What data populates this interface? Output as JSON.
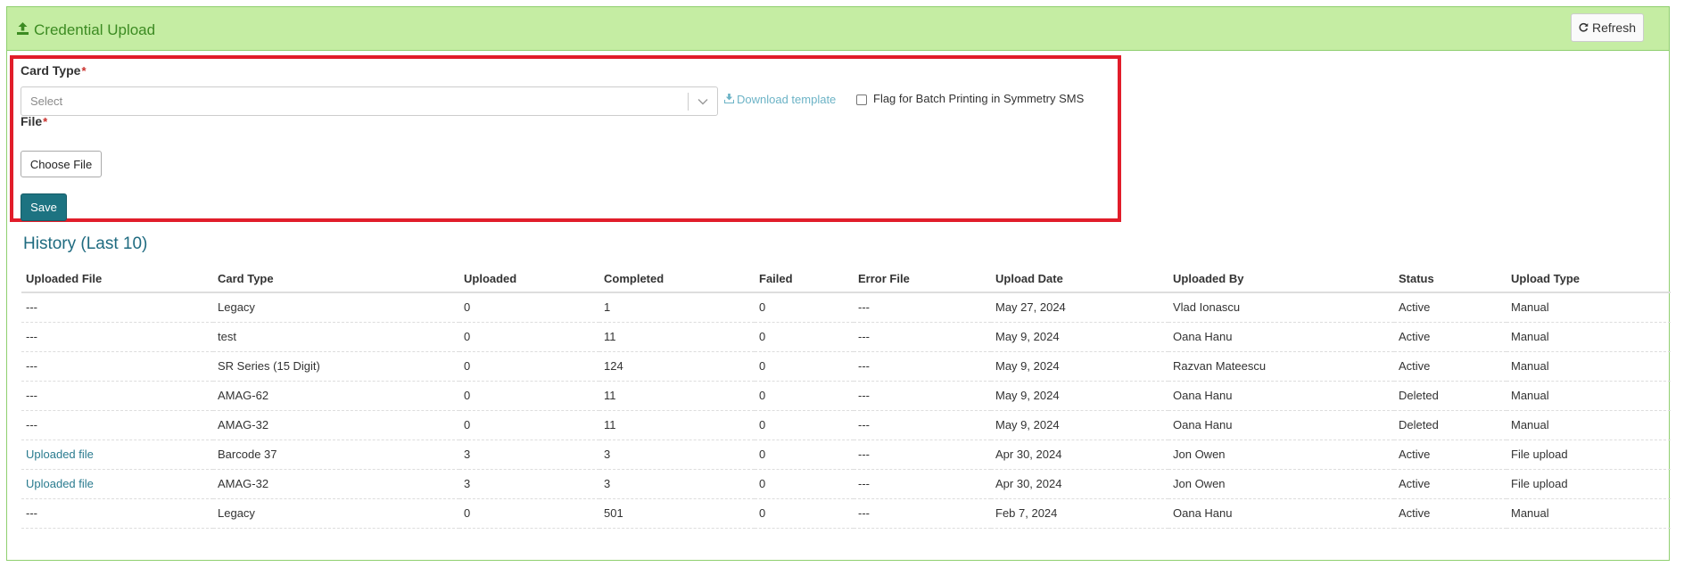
{
  "header": {
    "title": "Credential Upload",
    "title_icon": "upload-icon",
    "refresh_label": "Refresh",
    "refresh_icon": "refresh-icon"
  },
  "form": {
    "card_type_label": "Card Type",
    "required_mark": "*",
    "card_type_placeholder": "Select",
    "download_template_label": "Download template",
    "flag_label": "Flag for Batch Printing in Symmetry SMS",
    "flag_checked": false,
    "file_label": "File",
    "choose_file_label": "Choose File",
    "save_label": "Save"
  },
  "history": {
    "title": "History (Last 10)",
    "columns": [
      "Uploaded File",
      "Card Type",
      "Uploaded",
      "Completed",
      "Failed",
      "Error File",
      "Upload Date",
      "Uploaded By",
      "Status",
      "Upload Type"
    ],
    "rows": [
      {
        "uploaded_file": "---",
        "is_link": false,
        "card_type": "Legacy",
        "uploaded": "0",
        "completed": "1",
        "failed": "0",
        "error_file": "---",
        "upload_date": "May 27, 2024",
        "uploaded_by": "Vlad Ionascu",
        "status": "Active",
        "upload_type": "Manual"
      },
      {
        "uploaded_file": "---",
        "is_link": false,
        "card_type": "test",
        "uploaded": "0",
        "completed": "11",
        "failed": "0",
        "error_file": "---",
        "upload_date": "May 9, 2024",
        "uploaded_by": "Oana Hanu",
        "status": "Active",
        "upload_type": "Manual"
      },
      {
        "uploaded_file": "---",
        "is_link": false,
        "card_type": "SR Series (15 Digit)",
        "uploaded": "0",
        "completed": "124",
        "failed": "0",
        "error_file": "---",
        "upload_date": "May 9, 2024",
        "uploaded_by": "Razvan Mateescu",
        "status": "Active",
        "upload_type": "Manual"
      },
      {
        "uploaded_file": "---",
        "is_link": false,
        "card_type": "AMAG-62",
        "uploaded": "0",
        "completed": "11",
        "failed": "0",
        "error_file": "---",
        "upload_date": "May 9, 2024",
        "uploaded_by": "Oana Hanu",
        "status": "Deleted",
        "upload_type": "Manual"
      },
      {
        "uploaded_file": "---",
        "is_link": false,
        "card_type": "AMAG-32",
        "uploaded": "0",
        "completed": "11",
        "failed": "0",
        "error_file": "---",
        "upload_date": "May 9, 2024",
        "uploaded_by": "Oana Hanu",
        "status": "Deleted",
        "upload_type": "Manual"
      },
      {
        "uploaded_file": "Uploaded file",
        "is_link": true,
        "card_type": "Barcode 37",
        "uploaded": "3",
        "completed": "3",
        "failed": "0",
        "error_file": "---",
        "upload_date": "Apr 30, 2024",
        "uploaded_by": "Jon Owen",
        "status": "Active",
        "upload_type": "File upload"
      },
      {
        "uploaded_file": "Uploaded file",
        "is_link": true,
        "card_type": "AMAG-32",
        "uploaded": "3",
        "completed": "3",
        "failed": "0",
        "error_file": "---",
        "upload_date": "Apr 30, 2024",
        "uploaded_by": "Jon Owen",
        "status": "Active",
        "upload_type": "File upload"
      },
      {
        "uploaded_file": "---",
        "is_link": false,
        "card_type": "Legacy",
        "uploaded": "0",
        "completed": "501",
        "failed": "0",
        "error_file": "---",
        "upload_date": "Feb 7, 2024",
        "uploaded_by": "Oana Hanu",
        "status": "Active",
        "upload_type": "Manual"
      }
    ]
  },
  "colors": {
    "header_bg": "#c5eda3",
    "header_title": "#3c8b22",
    "highlight_border": "#e11d2a",
    "save_button": "#1d7381",
    "link": "#2a7b8f",
    "history_title": "#1f6b80"
  }
}
